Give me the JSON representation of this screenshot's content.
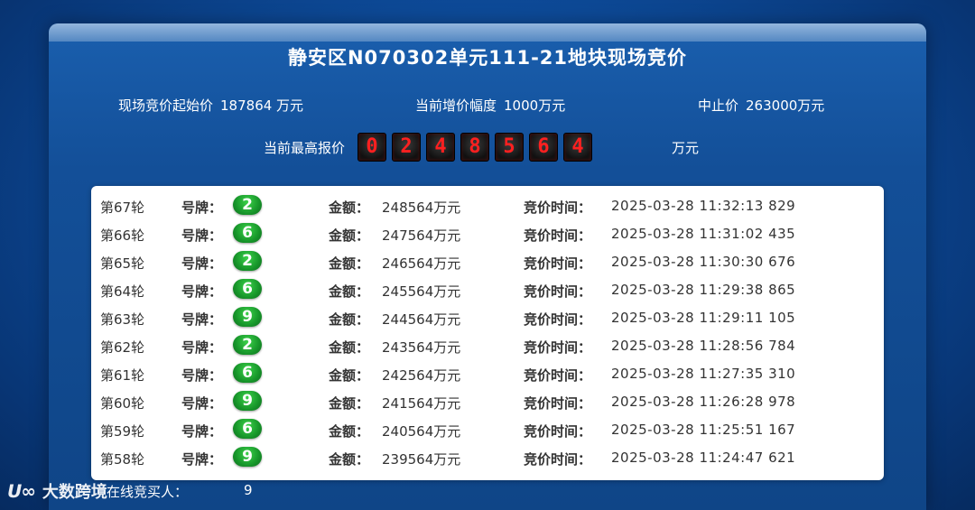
{
  "title": "静安区N070302单元111-21地块现场竞价",
  "info": {
    "start_label": "现场竞价起始价",
    "start_value": "187864 万元",
    "increment_label": "当前增价幅度",
    "increment_value": "1000万元",
    "stop_label": "中止价",
    "stop_value": "263000万元"
  },
  "highest": {
    "label": "当前最高报价",
    "digits": [
      "0",
      "2",
      "4",
      "8",
      "5",
      "6",
      "4"
    ],
    "unit": "万元"
  },
  "labels": {
    "plate": "号牌：",
    "amount": "金额：",
    "time": "竞价时间："
  },
  "bids": [
    {
      "round": "第67轮",
      "plate": "2",
      "amount": "248564万元",
      "time": "2025-03-28 11:32:13 829"
    },
    {
      "round": "第66轮",
      "plate": "6",
      "amount": "247564万元",
      "time": "2025-03-28 11:31:02 435"
    },
    {
      "round": "第65轮",
      "plate": "2",
      "amount": "246564万元",
      "time": "2025-03-28 11:30:30 676"
    },
    {
      "round": "第64轮",
      "plate": "6",
      "amount": "245564万元",
      "time": "2025-03-28 11:29:38 865"
    },
    {
      "round": "第63轮",
      "plate": "9",
      "amount": "244564万元",
      "time": "2025-03-28 11:29:11 105"
    },
    {
      "round": "第62轮",
      "plate": "2",
      "amount": "243564万元",
      "time": "2025-03-28 11:28:56 784"
    },
    {
      "round": "第61轮",
      "plate": "6",
      "amount": "242564万元",
      "time": "2025-03-28 11:27:35 310"
    },
    {
      "round": "第60轮",
      "plate": "9",
      "amount": "241564万元",
      "time": "2025-03-28 11:26:28 978"
    },
    {
      "round": "第59轮",
      "plate": "6",
      "amount": "240564万元",
      "time": "2025-03-28 11:25:51 167"
    },
    {
      "round": "第58轮",
      "plate": "9",
      "amount": "239564万元",
      "time": "2025-03-28 11:24:47 621"
    }
  ],
  "footer": {
    "label": "在线竞买人：",
    "count": "9"
  },
  "watermark": {
    "logo": "ᑌ∞",
    "text": "大数跨境"
  },
  "colors": {
    "background": "#0d4a98",
    "digit": "#ff2020",
    "badge": "#17962a"
  }
}
